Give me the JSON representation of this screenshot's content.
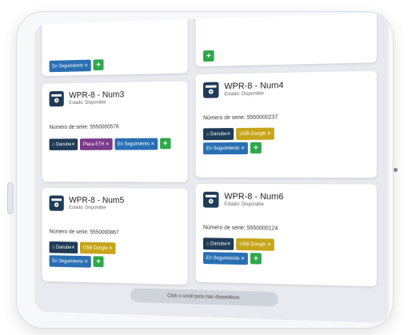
{
  "top_left_card": {
    "tag": "En Seguimiento ✕",
    "add_symbol": "+"
  },
  "top_right_card": {
    "add_symbol": "+"
  },
  "devices": [
    {
      "title": "WPR-8 - Num3",
      "status": "Estado: Disponible",
      "serial": "Número de serie: 5550000576",
      "tags": [
        "⌂ Danube✕",
        "Placa ETH ✕",
        "En Seguimiento ✕"
      ],
      "tag_colors": [
        "navy",
        "purple",
        "blue"
      ],
      "add_symbol": "+"
    },
    {
      "title": "WPR-8 - Num4",
      "status": "Estado: Disponible",
      "serial": "Número de serie: 5550000237",
      "tags": [
        "⌂ Danube✕",
        "USB Dongle ✕",
        "En Seguimiento ✕"
      ],
      "tag_colors": [
        "navy",
        "gold",
        "blue"
      ],
      "add_symbol": "+"
    },
    {
      "title": "WPR-8 - Num5",
      "status": "Estado: Disponible",
      "serial": "Número de serie: 5550000867",
      "tags": [
        "⌂ Danube✕",
        "USB Dongle ✕",
        "En Seguimiento ✕"
      ],
      "tag_colors": [
        "navy",
        "gold",
        "blue"
      ],
      "add_symbol": "+"
    },
    {
      "title": "WPR-8 - Num6",
      "status": "Estado: Disponible",
      "serial": "Número de serie: 5550000124",
      "tags": [
        "⌂ Danube✕",
        "USB Dongle ✕",
        "En Seguimiento ✕"
      ],
      "tag_colors": [
        "navy",
        "gold",
        "blue"
      ],
      "add_symbol": "+"
    }
  ],
  "scroll_hint": "Click o scroll para más dispositivos",
  "colors": {
    "primary_blue": "#2a6fb3",
    "navy": "#1f3b57",
    "purple": "#7a3a8b",
    "gold": "#c7a51a",
    "green": "#2da84a"
  }
}
